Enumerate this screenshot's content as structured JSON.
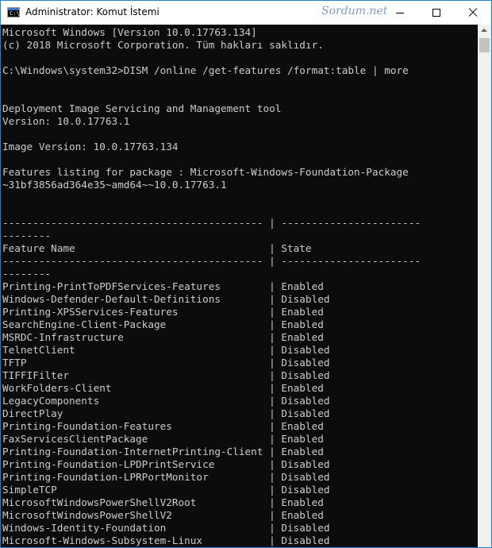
{
  "window": {
    "title": "Administrator: Komut İstemi",
    "icon_label": "C:\\.",
    "watermark": "Sordum.net",
    "controls": {
      "minimize": "minimize-icon",
      "maximize": "maximize-icon",
      "close": "close-icon"
    }
  },
  "console": {
    "lines": [
      "Microsoft Windows [Version 10.0.17763.134]",
      "(c) 2018 Microsoft Corporation. Tüm hakları saklıdır.",
      "",
      "C:\\Windows\\system32>DISM /online /get-features /format:table | more",
      "",
      "",
      "Deployment Image Servicing and Management tool",
      "Version: 10.0.17763.1",
      "",
      "Image Version: 10.0.17763.134",
      "",
      "Features listing for package : Microsoft-Windows-Foundation-Package",
      "~31bf3856ad364e35~amd64~~10.0.17763.1",
      "",
      "",
      "------------------------------------------- | -----------------------",
      "--------",
      "Feature Name                                | State",
      "------------------------------------------- | -----------------------",
      "--------",
      "Printing-PrintToPDFServices-Features        | Enabled",
      "Windows-Defender-Default-Definitions        | Disabled",
      "Printing-XPSServices-Features               | Enabled",
      "SearchEngine-Client-Package                 | Enabled",
      "MSRDC-Infrastructure                        | Enabled",
      "TelnetClient                                | Disabled",
      "TFTP                                        | Disabled",
      "TIFFIFilter                                 | Disabled",
      "WorkFolders-Client                          | Enabled",
      "LegacyComponents                            | Disabled",
      "DirectPlay                                  | Disabled",
      "Printing-Foundation-Features                | Enabled",
      "FaxServicesClientPackage                    | Enabled",
      "Printing-Foundation-InternetPrinting-Client | Enabled",
      "Printing-Foundation-LPDPrintService         | Disabled",
      "Printing-Foundation-LPRPortMonitor          | Disabled",
      "SimpleTCP                                   | Disabled",
      "MicrosoftWindowsPowerShellV2Root            | Enabled",
      "MicrosoftWindowsPowerShellV2                | Enabled",
      "Windows-Identity-Foundation                 | Disabled",
      "Microsoft-Windows-Subsystem-Linux           | Disabled"
    ]
  },
  "colors": {
    "console_bg": "#0c0c0c",
    "console_fg": "#cccccc",
    "window_border": "#1883d7"
  }
}
